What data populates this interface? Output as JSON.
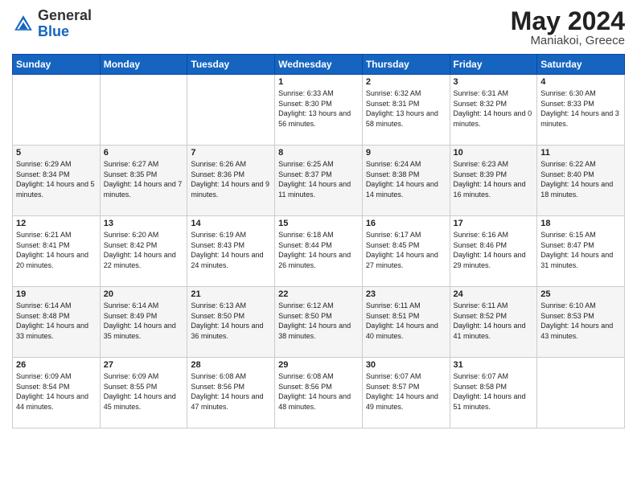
{
  "header": {
    "logo_general": "General",
    "logo_blue": "Blue",
    "title": "May 2024",
    "location": "Maniakoi, Greece"
  },
  "weekdays": [
    "Sunday",
    "Monday",
    "Tuesday",
    "Wednesday",
    "Thursday",
    "Friday",
    "Saturday"
  ],
  "weeks": [
    [
      {
        "day": "",
        "sunrise": "",
        "sunset": "",
        "daylight": ""
      },
      {
        "day": "",
        "sunrise": "",
        "sunset": "",
        "daylight": ""
      },
      {
        "day": "",
        "sunrise": "",
        "sunset": "",
        "daylight": ""
      },
      {
        "day": "1",
        "sunrise": "Sunrise: 6:33 AM",
        "sunset": "Sunset: 8:30 PM",
        "daylight": "Daylight: 13 hours and 56 minutes."
      },
      {
        "day": "2",
        "sunrise": "Sunrise: 6:32 AM",
        "sunset": "Sunset: 8:31 PM",
        "daylight": "Daylight: 13 hours and 58 minutes."
      },
      {
        "day": "3",
        "sunrise": "Sunrise: 6:31 AM",
        "sunset": "Sunset: 8:32 PM",
        "daylight": "Daylight: 14 hours and 0 minutes."
      },
      {
        "day": "4",
        "sunrise": "Sunrise: 6:30 AM",
        "sunset": "Sunset: 8:33 PM",
        "daylight": "Daylight: 14 hours and 3 minutes."
      }
    ],
    [
      {
        "day": "5",
        "sunrise": "Sunrise: 6:29 AM",
        "sunset": "Sunset: 8:34 PM",
        "daylight": "Daylight: 14 hours and 5 minutes."
      },
      {
        "day": "6",
        "sunrise": "Sunrise: 6:27 AM",
        "sunset": "Sunset: 8:35 PM",
        "daylight": "Daylight: 14 hours and 7 minutes."
      },
      {
        "day": "7",
        "sunrise": "Sunrise: 6:26 AM",
        "sunset": "Sunset: 8:36 PM",
        "daylight": "Daylight: 14 hours and 9 minutes."
      },
      {
        "day": "8",
        "sunrise": "Sunrise: 6:25 AM",
        "sunset": "Sunset: 8:37 PM",
        "daylight": "Daylight: 14 hours and 11 minutes."
      },
      {
        "day": "9",
        "sunrise": "Sunrise: 6:24 AM",
        "sunset": "Sunset: 8:38 PM",
        "daylight": "Daylight: 14 hours and 14 minutes."
      },
      {
        "day": "10",
        "sunrise": "Sunrise: 6:23 AM",
        "sunset": "Sunset: 8:39 PM",
        "daylight": "Daylight: 14 hours and 16 minutes."
      },
      {
        "day": "11",
        "sunrise": "Sunrise: 6:22 AM",
        "sunset": "Sunset: 8:40 PM",
        "daylight": "Daylight: 14 hours and 18 minutes."
      }
    ],
    [
      {
        "day": "12",
        "sunrise": "Sunrise: 6:21 AM",
        "sunset": "Sunset: 8:41 PM",
        "daylight": "Daylight: 14 hours and 20 minutes."
      },
      {
        "day": "13",
        "sunrise": "Sunrise: 6:20 AM",
        "sunset": "Sunset: 8:42 PM",
        "daylight": "Daylight: 14 hours and 22 minutes."
      },
      {
        "day": "14",
        "sunrise": "Sunrise: 6:19 AM",
        "sunset": "Sunset: 8:43 PM",
        "daylight": "Daylight: 14 hours and 24 minutes."
      },
      {
        "day": "15",
        "sunrise": "Sunrise: 6:18 AM",
        "sunset": "Sunset: 8:44 PM",
        "daylight": "Daylight: 14 hours and 26 minutes."
      },
      {
        "day": "16",
        "sunrise": "Sunrise: 6:17 AM",
        "sunset": "Sunset: 8:45 PM",
        "daylight": "Daylight: 14 hours and 27 minutes."
      },
      {
        "day": "17",
        "sunrise": "Sunrise: 6:16 AM",
        "sunset": "Sunset: 8:46 PM",
        "daylight": "Daylight: 14 hours and 29 minutes."
      },
      {
        "day": "18",
        "sunrise": "Sunrise: 6:15 AM",
        "sunset": "Sunset: 8:47 PM",
        "daylight": "Daylight: 14 hours and 31 minutes."
      }
    ],
    [
      {
        "day": "19",
        "sunrise": "Sunrise: 6:14 AM",
        "sunset": "Sunset: 8:48 PM",
        "daylight": "Daylight: 14 hours and 33 minutes."
      },
      {
        "day": "20",
        "sunrise": "Sunrise: 6:14 AM",
        "sunset": "Sunset: 8:49 PM",
        "daylight": "Daylight: 14 hours and 35 minutes."
      },
      {
        "day": "21",
        "sunrise": "Sunrise: 6:13 AM",
        "sunset": "Sunset: 8:50 PM",
        "daylight": "Daylight: 14 hours and 36 minutes."
      },
      {
        "day": "22",
        "sunrise": "Sunrise: 6:12 AM",
        "sunset": "Sunset: 8:50 PM",
        "daylight": "Daylight: 14 hours and 38 minutes."
      },
      {
        "day": "23",
        "sunrise": "Sunrise: 6:11 AM",
        "sunset": "Sunset: 8:51 PM",
        "daylight": "Daylight: 14 hours and 40 minutes."
      },
      {
        "day": "24",
        "sunrise": "Sunrise: 6:11 AM",
        "sunset": "Sunset: 8:52 PM",
        "daylight": "Daylight: 14 hours and 41 minutes."
      },
      {
        "day": "25",
        "sunrise": "Sunrise: 6:10 AM",
        "sunset": "Sunset: 8:53 PM",
        "daylight": "Daylight: 14 hours and 43 minutes."
      }
    ],
    [
      {
        "day": "26",
        "sunrise": "Sunrise: 6:09 AM",
        "sunset": "Sunset: 8:54 PM",
        "daylight": "Daylight: 14 hours and 44 minutes."
      },
      {
        "day": "27",
        "sunrise": "Sunrise: 6:09 AM",
        "sunset": "Sunset: 8:55 PM",
        "daylight": "Daylight: 14 hours and 45 minutes."
      },
      {
        "day": "28",
        "sunrise": "Sunrise: 6:08 AM",
        "sunset": "Sunset: 8:56 PM",
        "daylight": "Daylight: 14 hours and 47 minutes."
      },
      {
        "day": "29",
        "sunrise": "Sunrise: 6:08 AM",
        "sunset": "Sunset: 8:56 PM",
        "daylight": "Daylight: 14 hours and 48 minutes."
      },
      {
        "day": "30",
        "sunrise": "Sunrise: 6:07 AM",
        "sunset": "Sunset: 8:57 PM",
        "daylight": "Daylight: 14 hours and 49 minutes."
      },
      {
        "day": "31",
        "sunrise": "Sunrise: 6:07 AM",
        "sunset": "Sunset: 8:58 PM",
        "daylight": "Daylight: 14 hours and 51 minutes."
      },
      {
        "day": "",
        "sunrise": "",
        "sunset": "",
        "daylight": ""
      }
    ]
  ]
}
